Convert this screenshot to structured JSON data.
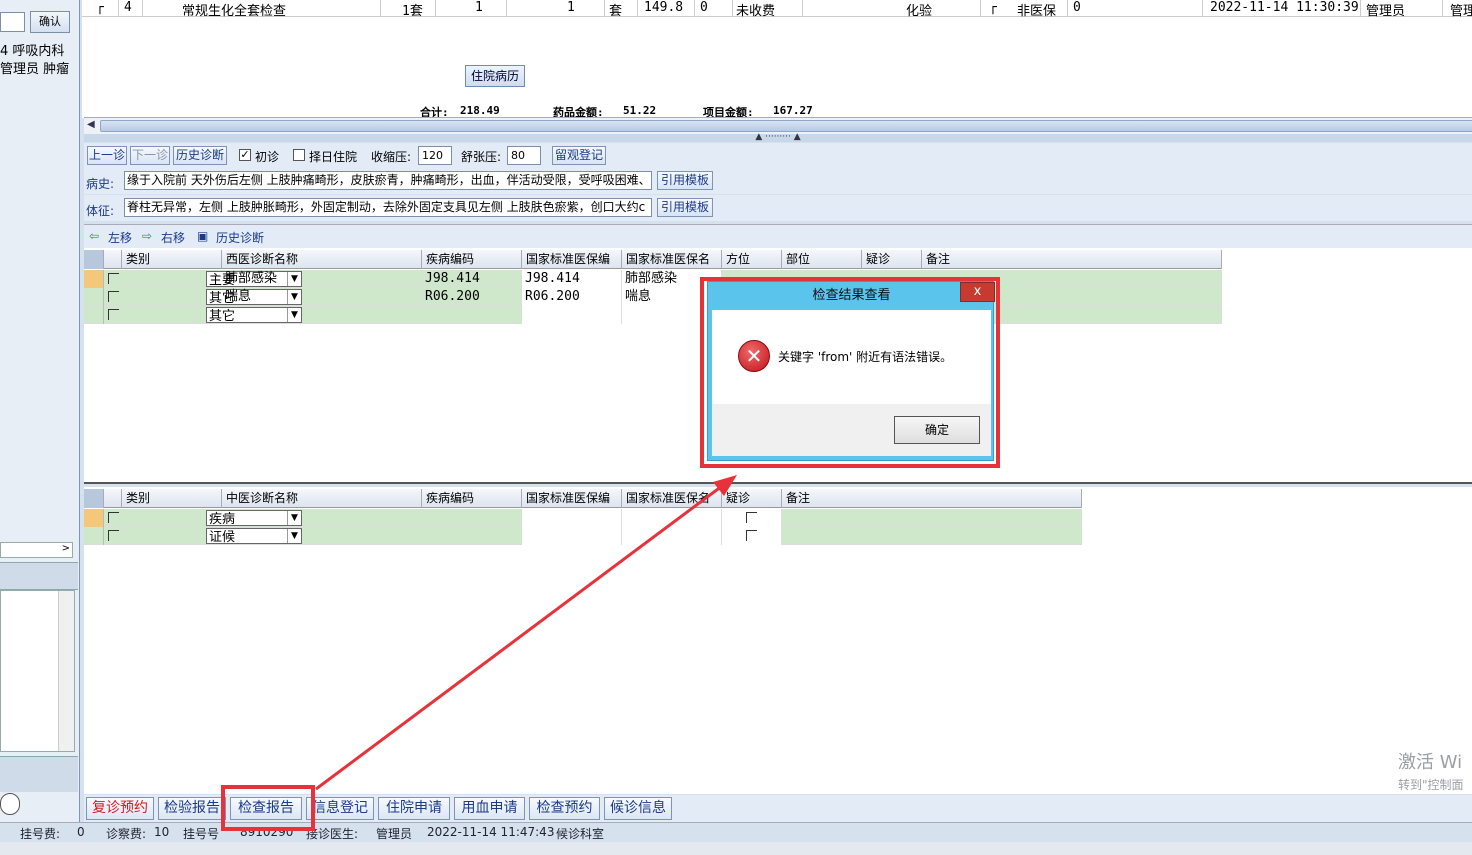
{
  "left_panel": {
    "confirm_label": "确认",
    "line1": "4  呼吸内科",
    "line2": "管理员  肿瘤"
  },
  "top_table": {
    "row": {
      "index": "4",
      "name": "常规生化全套检查",
      "unit1": "1套",
      "qty": "1",
      "qty2": "1",
      "unit2": "套",
      "price": "149.8",
      "zero": "0",
      "status": "未收费",
      "dept": "化验",
      "insurance": "非医保",
      "ins_zero": "0",
      "time": "2022-11-14 11:30:39",
      "operator": "管理员",
      "extra": "管理"
    },
    "inpatient_record_button": "住院病历",
    "total_label": "合计:",
    "total_value": "218.49",
    "drug_label": "药品金额:",
    "drug_value": "51.22",
    "item_label": "项目金额:",
    "item_value": "167.27"
  },
  "toolbar1": {
    "prev": "上一诊",
    "next": "下一诊",
    "history": "历史诊断",
    "first_visit": "初诊",
    "select_day_admission": "择日住院",
    "systolic_label": "收缩压:",
    "systolic_value": "120",
    "diastolic_label": "舒张压:",
    "diastolic_value": "80",
    "observation": "留观登记"
  },
  "history_row": {
    "label": "病史:",
    "text": "缘于入院前  天外伤后左侧  上肢肿痛畸形，皮肤瘀青，肿痛畸形，出血，伴活动受限，受呼吸困难、",
    "template": "引用模板"
  },
  "signs_row": {
    "label": "体征:",
    "text": "脊柱无异常，左侧  上肢肿胀畸形，外固定制动，去除外固定支具见左侧  上肢肤色瘀紫，创口大约c",
    "template": "引用模板"
  },
  "toolbar2": {
    "left": "左移",
    "right": "右移",
    "history": "历史诊断"
  },
  "western_grid": {
    "headers": [
      "类别",
      "西医诊断名称",
      "疾病编码",
      "国家标准医保编",
      "国家标准医保名",
      "方位",
      "部位",
      "疑诊",
      "备注"
    ],
    "rows": [
      {
        "category": "主要",
        "name": "肺部感染",
        "code": "J98.414",
        "ins_code": "J98.414",
        "ins_name": "肺部感染"
      },
      {
        "category": "其它",
        "name": "喘息",
        "code": "R06.200",
        "ins_code": "R06.200",
        "ins_name": "喘息"
      },
      {
        "category": "其它",
        "name": "",
        "code": "",
        "ins_code": "",
        "ins_name": ""
      }
    ]
  },
  "chinese_grid": {
    "headers": [
      "类别",
      "中医诊断名称",
      "疾病编码",
      "国家标准医保编",
      "国家标准医保名",
      "疑诊",
      "备注"
    ],
    "rows": [
      {
        "category": "疾病"
      },
      {
        "category": "证候"
      }
    ]
  },
  "tabs": [
    "复诊预约",
    "检验报告",
    "检查报告",
    "信息登记",
    "住院申请",
    "用血申请",
    "检查预约",
    "候诊信息"
  ],
  "status_bar": {
    "reg_fee_label": "挂号费:",
    "reg_fee": "0",
    "diag_fee_label": "诊察费:",
    "diag_fee": "10",
    "reg_no_label": "挂号号",
    "reg_no": "8910290",
    "doctor_label": "接诊医生:",
    "doctor": "管理员",
    "time": "2022-11-14 11:47:43",
    "dept": "候诊科室"
  },
  "dialog": {
    "title": "检查结果查看",
    "close": "x",
    "message": "关键字 'from' 附近有语法错误。",
    "ok": "确定"
  },
  "watermark": {
    "line1": "激活 Wi",
    "line2": "转到\"控制面"
  },
  "colors": {
    "highlight": "#e8323a",
    "dialog_title": "#5ac4ed",
    "grid_green": "#cfe8cc"
  }
}
